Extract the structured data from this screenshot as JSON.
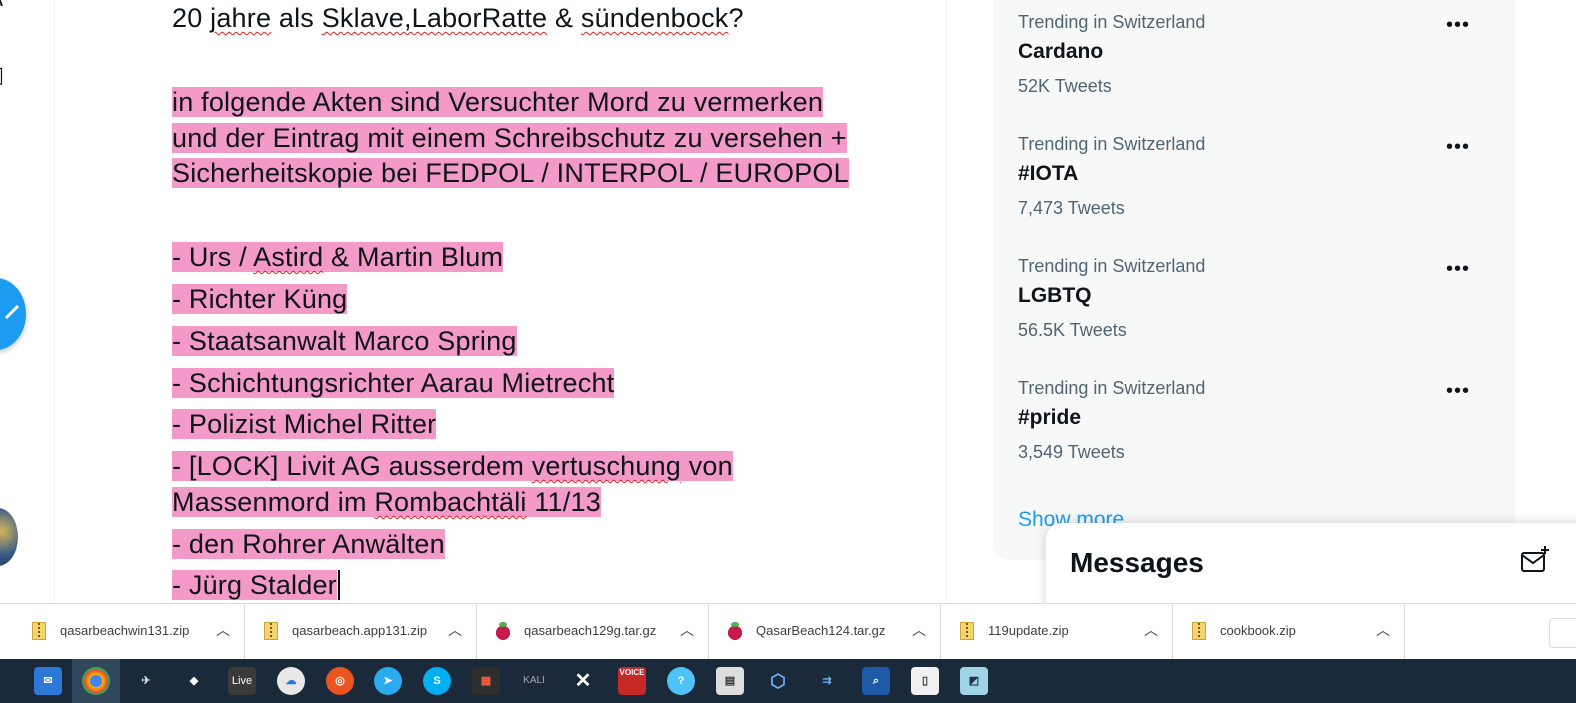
{
  "tweet": {
    "line1": [
      "20 ",
      "jahre",
      " als ",
      "Sklave,LaborRatte",
      " & ",
      "sündenbock",
      "?"
    ],
    "para2": [
      "in folgende Akten sind Versuchter Mord zu vermerken",
      "und der Eintrag mit einem Schreibschutz zu versehen +",
      "Sicherheitskopie bei FEDPOL / INTERPOL / EUROPOL"
    ],
    "list": {
      "l1": [
        "- Urs / ",
        "Astird",
        " & Martin Blum "
      ],
      "l2": "- Richter Küng",
      "l3": "- Staatsanwalt Marco Spring",
      "l4": "- Schichtungsrichter Aarau Mietrecht",
      "l5": "- Polizist Michel Ritter",
      "l6": [
        "- [LOCK] Livit AG ausserdem ",
        "vertuschung",
        " von "
      ],
      "l7": [
        "Massenmord im ",
        "Rombachtäli",
        " 11/13"
      ],
      "l8": "- den Rohrer Anwälten",
      "l9": "- Jürg Stalder"
    }
  },
  "trends": [
    {
      "context": "Trending in Switzerland",
      "name": "Cardano",
      "count": "52K Tweets"
    },
    {
      "context": "Trending in Switzerland",
      "name": "#IOTA",
      "count": "7,473 Tweets"
    },
    {
      "context": "Trending in Switzerland",
      "name": "LGBTQ",
      "count": "56.5K Tweets"
    },
    {
      "context": "Trending in Switzerland",
      "name": "#pride",
      "count": "3,549 Tweets"
    }
  ],
  "show_more": "Show more",
  "messages": {
    "title": "Messages"
  },
  "downloads": [
    {
      "name": "qasarbeachwin131.zip",
      "icon": "zip-icon"
    },
    {
      "name": "qasarbeach.app131.zip",
      "icon": "zip-icon"
    },
    {
      "name": "qasarbeach129g.tar.gz",
      "icon": "raspberry-icon"
    },
    {
      "name": "QasarBeach124.tar.gz",
      "icon": "raspberry-icon"
    },
    {
      "name": "119update.zip",
      "icon": "zip-icon"
    },
    {
      "name": "cookbook.zip",
      "icon": "zip-icon"
    }
  ],
  "taskbar": {
    "live_label": "Live",
    "kali_label": "KALI",
    "voicemeeter_label": "VOICE"
  },
  "colors": {
    "highlight": "#f49ac8",
    "twitter_blue": "#1d9bf0",
    "taskbar": "#1b2a3a"
  }
}
